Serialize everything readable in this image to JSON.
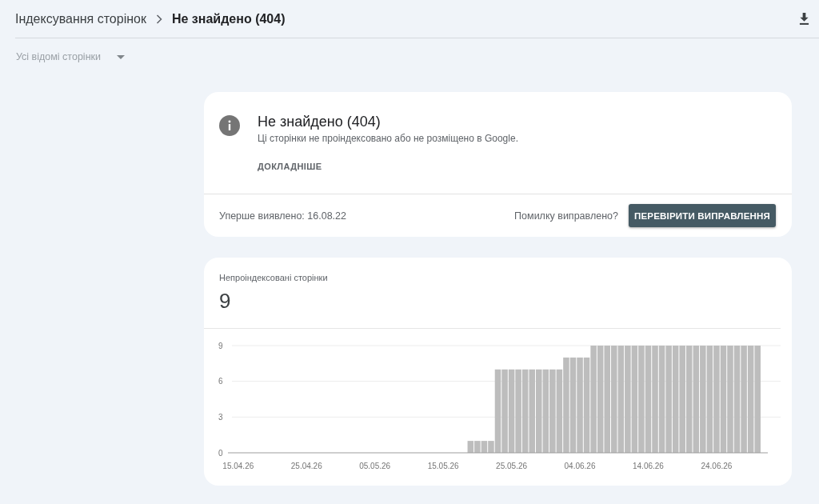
{
  "breadcrumb": [
    {
      "label": "Індексування сторінок"
    },
    {
      "label": "Не знайдено (404)"
    }
  ],
  "filter": {
    "label": "Усі відомі сторінки"
  },
  "issue_card": {
    "title": "Не знайдено (404)",
    "description": "Ці сторінки не проіндексовано або не розміщено в Google.",
    "link": "ДОКЛАДНІШЕ",
    "first_detected": "Уперше виявлено: 16.08.22",
    "question": "Помилку виправлено?",
    "button": "ПЕРЕВІРИТИ ВИПРАВЛЕННЯ"
  },
  "chart_card": {
    "label": "Непроіндексовані сторінки",
    "total": "9",
    "chart_data": {
      "type": "bar",
      "categories": [
        "15.04.26",
        null,
        null,
        null,
        null,
        null,
        null,
        null,
        null,
        null,
        "25.04.26",
        null,
        null,
        null,
        null,
        null,
        null,
        null,
        null,
        null,
        "05.05.26",
        null,
        null,
        null,
        null,
        null,
        null,
        null,
        null,
        null,
        "15.05.26",
        null,
        null,
        null,
        null,
        null,
        null,
        null,
        null,
        null,
        "25.05.26",
        null,
        null,
        null,
        null,
        null,
        null,
        null,
        null,
        null,
        "04.06.26",
        null,
        null,
        null,
        null,
        null,
        null,
        null,
        null,
        null,
        "14.06.26",
        null,
        null,
        null,
        null,
        null,
        null,
        null,
        null,
        null,
        "24.06.26",
        null,
        null,
        null,
        null,
        null,
        null
      ],
      "values": [
        0,
        0,
        0,
        0,
        0,
        0,
        0,
        0,
        0,
        0,
        0,
        0,
        0,
        0,
        0,
        0,
        0,
        0,
        0,
        0,
        0,
        0,
        0,
        0,
        0,
        0,
        0,
        0,
        0,
        0,
        0,
        0,
        0,
        0,
        1,
        1,
        1,
        1,
        7,
        7,
        7,
        7,
        7,
        7,
        7,
        7,
        7,
        7,
        8,
        8,
        8,
        8,
        9,
        9,
        9,
        9,
        9,
        9,
        9,
        9,
        9,
        9,
        9,
        9,
        9,
        9,
        9,
        9,
        9,
        9,
        9,
        9,
        9,
        9,
        9,
        9,
        9
      ],
      "ylim": [
        0,
        9
      ],
      "yticks": [
        0,
        3,
        6,
        9
      ]
    }
  }
}
